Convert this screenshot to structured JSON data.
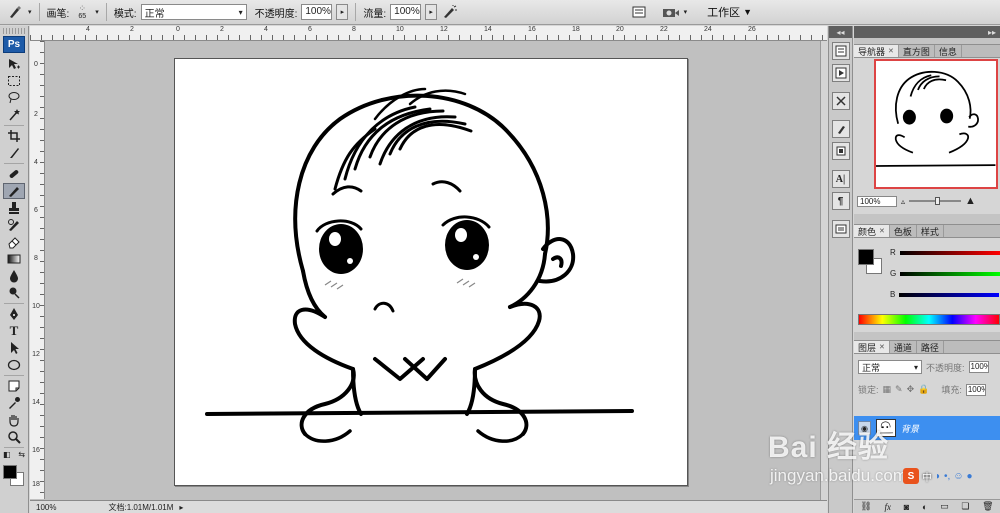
{
  "optionsBar": {
    "brush_label": "画笔:",
    "brush_size": "65",
    "mode_label": "模式:",
    "mode_value": "正常",
    "opacity_label": "不透明度:",
    "opacity_value": "100%",
    "flow_label": "流量:",
    "flow_value": "100%",
    "workspace_label": "工作区"
  },
  "toolbar": {
    "logo": "Ps",
    "tools": [
      "move",
      "marquee",
      "lasso",
      "quick-select",
      "crop",
      "slice",
      "healing",
      "brush",
      "stamp",
      "history-brush",
      "eraser",
      "gradient",
      "blur",
      "dodge",
      "pen",
      "type",
      "path-select",
      "shape",
      "notes",
      "eyedropper",
      "hand",
      "zoom"
    ],
    "active_tool": "brush",
    "foreground": "#000000",
    "background": "#ffffff"
  },
  "rulers": {
    "top": [
      "4",
      "2",
      "0",
      "2",
      "4",
      "6",
      "8",
      "10",
      "12",
      "14",
      "16",
      "18",
      "20",
      "22",
      "24",
      "26"
    ],
    "left": [
      "0",
      "2",
      "4",
      "6",
      "8",
      "10",
      "12",
      "14",
      "16",
      "18"
    ]
  },
  "status": {
    "zoom": "100%",
    "doc": "文档:1.01M/1.01M"
  },
  "navigator": {
    "tabs": [
      {
        "label": "导航器",
        "closable": true
      },
      {
        "label": "直方图",
        "closable": false
      },
      {
        "label": "信息",
        "closable": false
      }
    ],
    "zoom": "100%"
  },
  "color": {
    "tabs": [
      {
        "label": "颜色",
        "closable": true
      },
      {
        "label": "色板",
        "closable": false
      },
      {
        "label": "样式",
        "closable": false
      }
    ],
    "channels": [
      {
        "name": "R",
        "value": "0",
        "gradient_end": "#ff0000"
      },
      {
        "name": "G",
        "value": "0",
        "gradient_end": "#00ff00"
      },
      {
        "name": "B",
        "value": "0",
        "gradient_end": "#0000ff"
      }
    ]
  },
  "layers": {
    "tabs": [
      {
        "label": "图层",
        "closable": true
      },
      {
        "label": "通道",
        "closable": false
      },
      {
        "label": "路径",
        "closable": false
      }
    ],
    "blend_mode": "正常",
    "opacity_label": "不透明度:",
    "lock_label": "锁定:",
    "fill_label": "填充:",
    "opacity_value": "100%",
    "fill_value": "100%",
    "layer_name": "背景"
  },
  "watermark": {
    "text": "Bai 经验",
    "url": "jingyan.baidu.com",
    "ime": "中"
  }
}
